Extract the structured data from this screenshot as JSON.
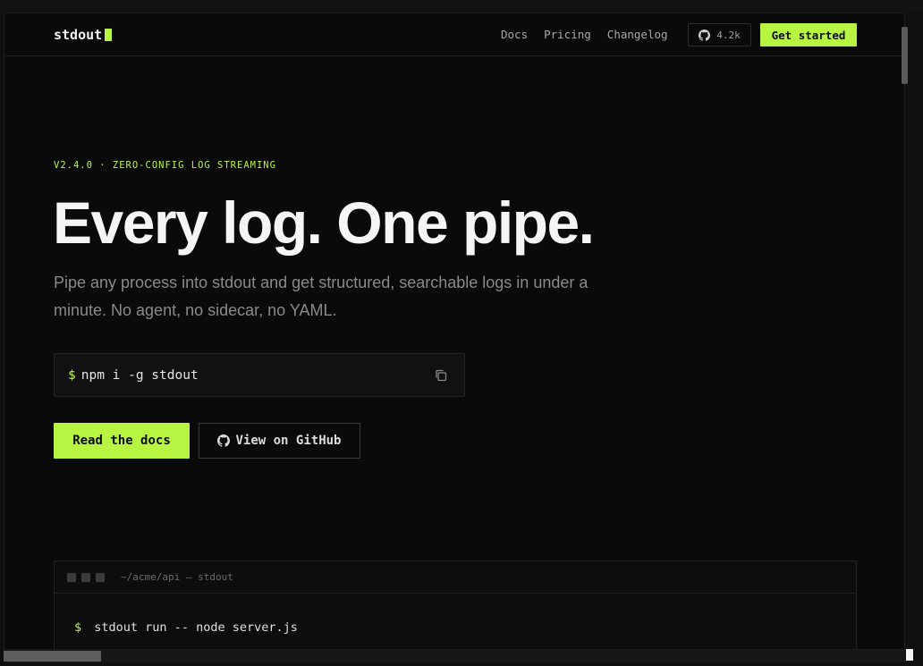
{
  "nav": {
    "logo": "stdout",
    "links": [
      "Docs",
      "Pricing",
      "Changelog"
    ],
    "github_count": "4.2k",
    "cta": "Get started"
  },
  "hero": {
    "eyebrow": "V2.4.0 · ZERO-CONFIG LOG STREAMING",
    "title": "Every log. One pipe.",
    "subtitle": "Pipe any process into stdout and get structured, searchable logs in under a minute. No agent, no sidecar, no YAML.",
    "install_prompt": "$",
    "install_command": "npm i -g stdout",
    "primary_button": "Read the docs",
    "secondary_button": "View on GitHub"
  },
  "terminal": {
    "title": "~/acme/api — stdout",
    "prompt": "$",
    "command": "stdout run -- node server.js"
  },
  "colors": {
    "accent": "#b8f442",
    "background": "#0a0a0a"
  }
}
